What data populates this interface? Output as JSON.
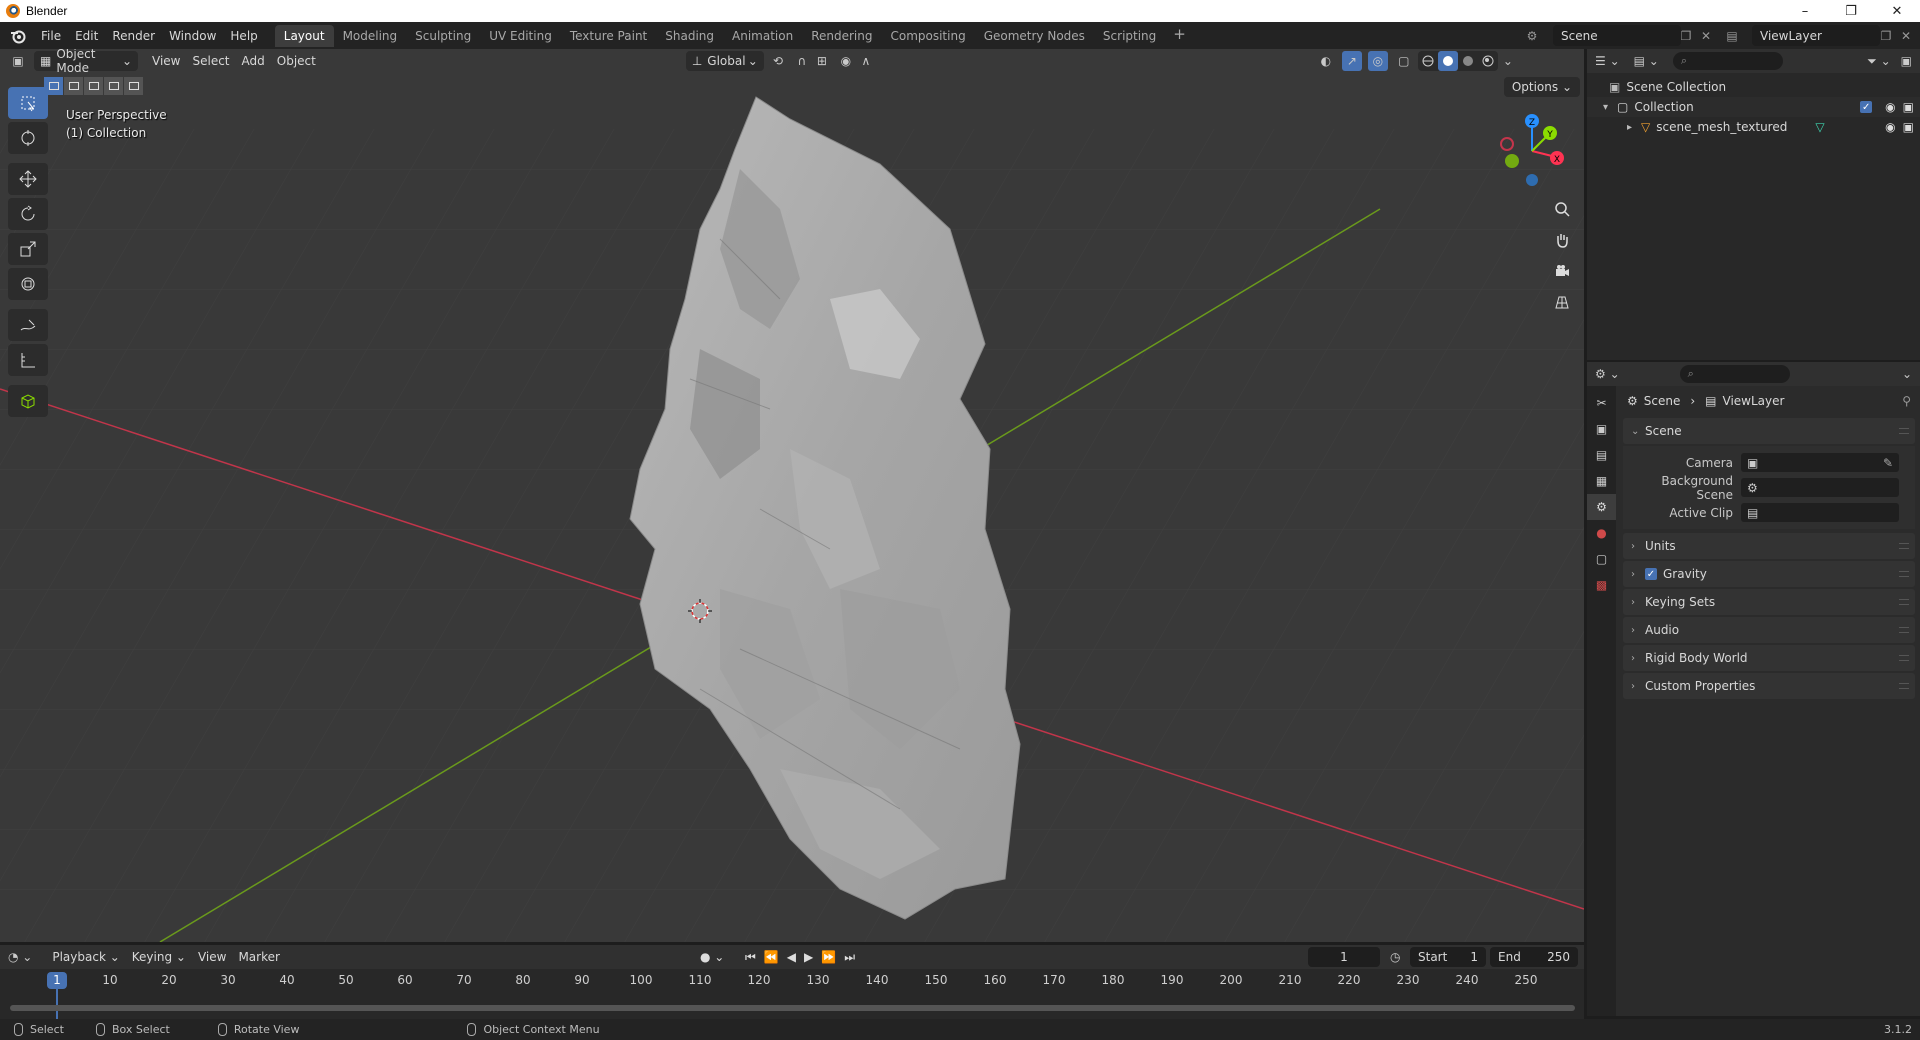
{
  "os_window": {
    "title": "Blender",
    "buttons": [
      "–",
      "❐",
      "✕"
    ]
  },
  "topbar": {
    "menus": [
      "File",
      "Edit",
      "Render",
      "Window",
      "Help"
    ],
    "workspaces": [
      "Layout",
      "Modeling",
      "Sculpting",
      "UV Editing",
      "Texture Paint",
      "Shading",
      "Animation",
      "Rendering",
      "Compositing",
      "Geometry Nodes",
      "Scripting"
    ],
    "active_workspace": "Layout",
    "add_tab": "+",
    "scene": "Scene",
    "view_layer": "ViewLayer"
  },
  "viewport": {
    "mode": "Object Mode",
    "menus": [
      "View",
      "Select",
      "Add",
      "Object"
    ],
    "orientation": "Global",
    "options_label": "Options",
    "overlay_text_line1": "User Perspective",
    "overlay_text_line2": "(1) Collection",
    "gizmo_axes": {
      "x": "X",
      "y": "Y",
      "z": "Z"
    },
    "tools": [
      "select-box",
      "cursor",
      "move",
      "rotate",
      "scale",
      "transform",
      "annotate",
      "measure",
      "add-cube"
    ]
  },
  "outliner": {
    "scene_collection": "Scene Collection",
    "collection": "Collection",
    "object": "scene_mesh_textured"
  },
  "properties": {
    "breadcrumb_scene": "Scene",
    "breadcrumb_sep": "›",
    "breadcrumb_layer": "ViewLayer",
    "scene_panel": "Scene",
    "camera_label": "Camera",
    "background_scene_label": "Background Scene",
    "active_clip_label": "Active Clip",
    "panels": [
      "Units",
      "Gravity",
      "Keying Sets",
      "Audio",
      "Rigid Body World",
      "Custom Properties"
    ],
    "gravity_enabled": true
  },
  "timeline": {
    "menus": [
      "Playback",
      "Keying",
      "View",
      "Marker"
    ],
    "current_frame": "1",
    "start_label": "Start",
    "start_value": "1",
    "end_label": "End",
    "end_value": "250",
    "ticks": [
      "10",
      "20",
      "30",
      "40",
      "50",
      "60",
      "70",
      "80",
      "90",
      "100",
      "110",
      "120",
      "130",
      "140",
      "150",
      "160",
      "170",
      "180",
      "190",
      "200",
      "210",
      "220",
      "230",
      "240",
      "250"
    ]
  },
  "statusbar": {
    "select": "Select",
    "box_select": "Box Select",
    "rotate_view": "Rotate View",
    "context_menu": "Object Context Menu",
    "version": "3.1.2"
  },
  "colors": {
    "accent": "#4772b3",
    "x_axis": "#ff3352",
    "y_axis": "#8bdc00",
    "z_axis": "#2890ff"
  }
}
